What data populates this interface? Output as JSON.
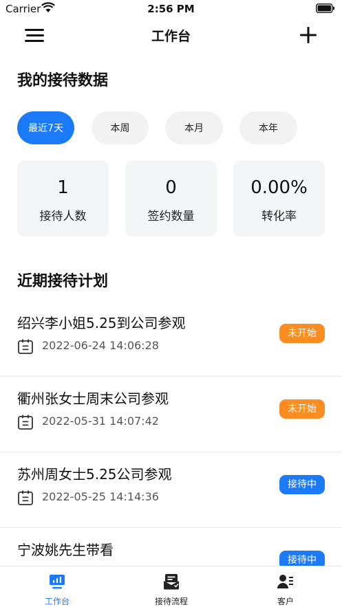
{
  "status_bar": {
    "carrier": "Carrier",
    "time": "2:56 PM"
  },
  "nav": {
    "title": "工作台"
  },
  "reception": {
    "title": "我的接待数据",
    "filters": [
      "最近7天",
      "本周",
      "本月",
      "本年"
    ],
    "active_filter": "最近7天",
    "stats": [
      {
        "value": "1",
        "label": "接待人数"
      },
      {
        "value": "0",
        "label": "签约数量"
      },
      {
        "value": "0.00%",
        "label": "转化率"
      }
    ]
  },
  "plans": {
    "title": "近期接待计划",
    "items": [
      {
        "title": "绍兴李小姐5.25到公司参观",
        "date": "2022-06-24 14:06:28",
        "status": "未开始"
      },
      {
        "title": "衢州张女士周末公司参观",
        "date": "2022-05-31 14:07:42",
        "status": "未开始"
      },
      {
        "title": "苏州周女士5.25公司参观",
        "date": "2022-05-25 14:14:36",
        "status": "接待中"
      },
      {
        "title": "宁波姚先生带看",
        "date": "",
        "status": "接待中"
      }
    ]
  },
  "tabs": [
    {
      "label": "工作台",
      "icon": "dashboard-icon"
    },
    {
      "label": "接待流程",
      "icon": "process-icon"
    },
    {
      "label": "客户",
      "icon": "customer-icon"
    }
  ],
  "colors": {
    "accent": "#1a7af8",
    "pending": "#fb8c1f",
    "card_bg": "#f4f5f7"
  }
}
